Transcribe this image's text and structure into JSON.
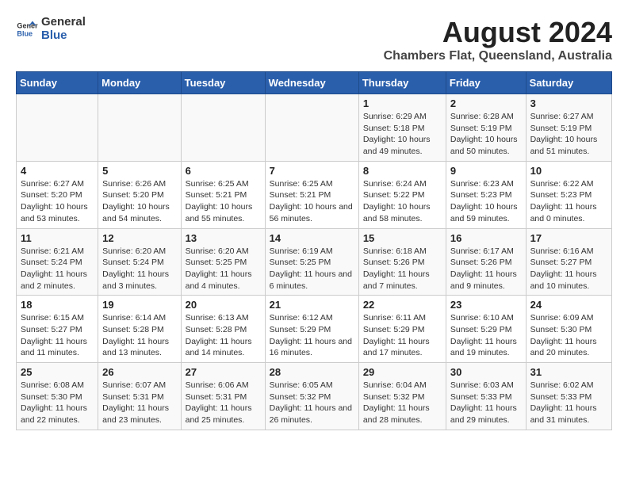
{
  "header": {
    "logo_general": "General",
    "logo_blue": "Blue",
    "title": "August 2024",
    "subtitle": "Chambers Flat, Queensland, Australia"
  },
  "calendar": {
    "columns": [
      "Sunday",
      "Monday",
      "Tuesday",
      "Wednesday",
      "Thursday",
      "Friday",
      "Saturday"
    ],
    "weeks": [
      [
        {
          "day": "",
          "info": ""
        },
        {
          "day": "",
          "info": ""
        },
        {
          "day": "",
          "info": ""
        },
        {
          "day": "",
          "info": ""
        },
        {
          "day": "1",
          "info": "Sunrise: 6:29 AM\nSunset: 5:18 PM\nDaylight: 10 hours and 49 minutes."
        },
        {
          "day": "2",
          "info": "Sunrise: 6:28 AM\nSunset: 5:19 PM\nDaylight: 10 hours and 50 minutes."
        },
        {
          "day": "3",
          "info": "Sunrise: 6:27 AM\nSunset: 5:19 PM\nDaylight: 10 hours and 51 minutes."
        }
      ],
      [
        {
          "day": "4",
          "info": "Sunrise: 6:27 AM\nSunset: 5:20 PM\nDaylight: 10 hours and 53 minutes."
        },
        {
          "day": "5",
          "info": "Sunrise: 6:26 AM\nSunset: 5:20 PM\nDaylight: 10 hours and 54 minutes."
        },
        {
          "day": "6",
          "info": "Sunrise: 6:25 AM\nSunset: 5:21 PM\nDaylight: 10 hours and 55 minutes."
        },
        {
          "day": "7",
          "info": "Sunrise: 6:25 AM\nSunset: 5:21 PM\nDaylight: 10 hours and 56 minutes."
        },
        {
          "day": "8",
          "info": "Sunrise: 6:24 AM\nSunset: 5:22 PM\nDaylight: 10 hours and 58 minutes."
        },
        {
          "day": "9",
          "info": "Sunrise: 6:23 AM\nSunset: 5:23 PM\nDaylight: 10 hours and 59 minutes."
        },
        {
          "day": "10",
          "info": "Sunrise: 6:22 AM\nSunset: 5:23 PM\nDaylight: 11 hours and 0 minutes."
        }
      ],
      [
        {
          "day": "11",
          "info": "Sunrise: 6:21 AM\nSunset: 5:24 PM\nDaylight: 11 hours and 2 minutes."
        },
        {
          "day": "12",
          "info": "Sunrise: 6:20 AM\nSunset: 5:24 PM\nDaylight: 11 hours and 3 minutes."
        },
        {
          "day": "13",
          "info": "Sunrise: 6:20 AM\nSunset: 5:25 PM\nDaylight: 11 hours and 4 minutes."
        },
        {
          "day": "14",
          "info": "Sunrise: 6:19 AM\nSunset: 5:25 PM\nDaylight: 11 hours and 6 minutes."
        },
        {
          "day": "15",
          "info": "Sunrise: 6:18 AM\nSunset: 5:26 PM\nDaylight: 11 hours and 7 minutes."
        },
        {
          "day": "16",
          "info": "Sunrise: 6:17 AM\nSunset: 5:26 PM\nDaylight: 11 hours and 9 minutes."
        },
        {
          "day": "17",
          "info": "Sunrise: 6:16 AM\nSunset: 5:27 PM\nDaylight: 11 hours and 10 minutes."
        }
      ],
      [
        {
          "day": "18",
          "info": "Sunrise: 6:15 AM\nSunset: 5:27 PM\nDaylight: 11 hours and 11 minutes."
        },
        {
          "day": "19",
          "info": "Sunrise: 6:14 AM\nSunset: 5:28 PM\nDaylight: 11 hours and 13 minutes."
        },
        {
          "day": "20",
          "info": "Sunrise: 6:13 AM\nSunset: 5:28 PM\nDaylight: 11 hours and 14 minutes."
        },
        {
          "day": "21",
          "info": "Sunrise: 6:12 AM\nSunset: 5:29 PM\nDaylight: 11 hours and 16 minutes."
        },
        {
          "day": "22",
          "info": "Sunrise: 6:11 AM\nSunset: 5:29 PM\nDaylight: 11 hours and 17 minutes."
        },
        {
          "day": "23",
          "info": "Sunrise: 6:10 AM\nSunset: 5:29 PM\nDaylight: 11 hours and 19 minutes."
        },
        {
          "day": "24",
          "info": "Sunrise: 6:09 AM\nSunset: 5:30 PM\nDaylight: 11 hours and 20 minutes."
        }
      ],
      [
        {
          "day": "25",
          "info": "Sunrise: 6:08 AM\nSunset: 5:30 PM\nDaylight: 11 hours and 22 minutes."
        },
        {
          "day": "26",
          "info": "Sunrise: 6:07 AM\nSunset: 5:31 PM\nDaylight: 11 hours and 23 minutes."
        },
        {
          "day": "27",
          "info": "Sunrise: 6:06 AM\nSunset: 5:31 PM\nDaylight: 11 hours and 25 minutes."
        },
        {
          "day": "28",
          "info": "Sunrise: 6:05 AM\nSunset: 5:32 PM\nDaylight: 11 hours and 26 minutes."
        },
        {
          "day": "29",
          "info": "Sunrise: 6:04 AM\nSunset: 5:32 PM\nDaylight: 11 hours and 28 minutes."
        },
        {
          "day": "30",
          "info": "Sunrise: 6:03 AM\nSunset: 5:33 PM\nDaylight: 11 hours and 29 minutes."
        },
        {
          "day": "31",
          "info": "Sunrise: 6:02 AM\nSunset: 5:33 PM\nDaylight: 11 hours and 31 minutes."
        }
      ]
    ]
  }
}
